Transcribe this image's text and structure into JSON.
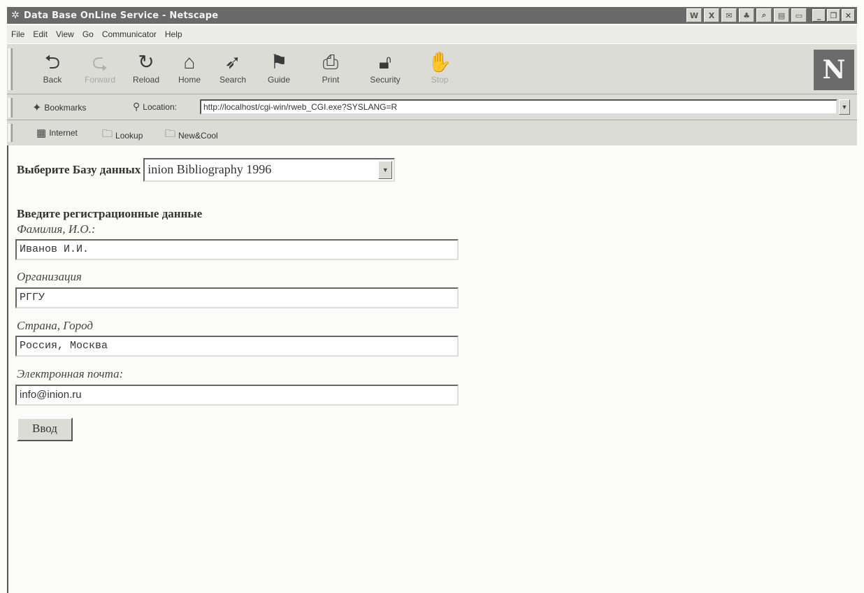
{
  "window": {
    "title": "Data Base OnLine Service - Netscape"
  },
  "menu": [
    "File",
    "Edit",
    "View",
    "Go",
    "Communicator",
    "Help"
  ],
  "nav_buttons": [
    {
      "label": "Back",
      "enabled": true
    },
    {
      "label": "Forward",
      "enabled": false
    },
    {
      "label": "Reload",
      "enabled": true
    },
    {
      "label": "Home",
      "enabled": true
    },
    {
      "label": "Search",
      "enabled": true
    },
    {
      "label": "Guide",
      "enabled": true
    },
    {
      "label": "Print",
      "enabled": true
    },
    {
      "label": "Security",
      "enabled": true
    },
    {
      "label": "Stop",
      "enabled": false
    }
  ],
  "location": {
    "bookmarks_label": "Bookmarks",
    "location_label": "Location:",
    "url": "http://localhost/cgi-win/rweb_CGI.exe?SYSLANG=R"
  },
  "personal_toolbar": [
    "Internet",
    "Lookup",
    "New&Cool"
  ],
  "form": {
    "db_label": "Выберите Базу данных",
    "db_selected": "inion Bibliography 1996",
    "reg_title": "Введите регистрационные данные",
    "fields": [
      {
        "label": "Фамилия, И.О.:",
        "value": "Иванов И.И."
      },
      {
        "label": "Организация",
        "value": "РГГУ"
      },
      {
        "label": "Страна, Город",
        "value": "Россия, Москва"
      },
      {
        "label": "Электронная почта:",
        "value": "info@inion.ru"
      }
    ],
    "submit_label": "Ввод"
  }
}
